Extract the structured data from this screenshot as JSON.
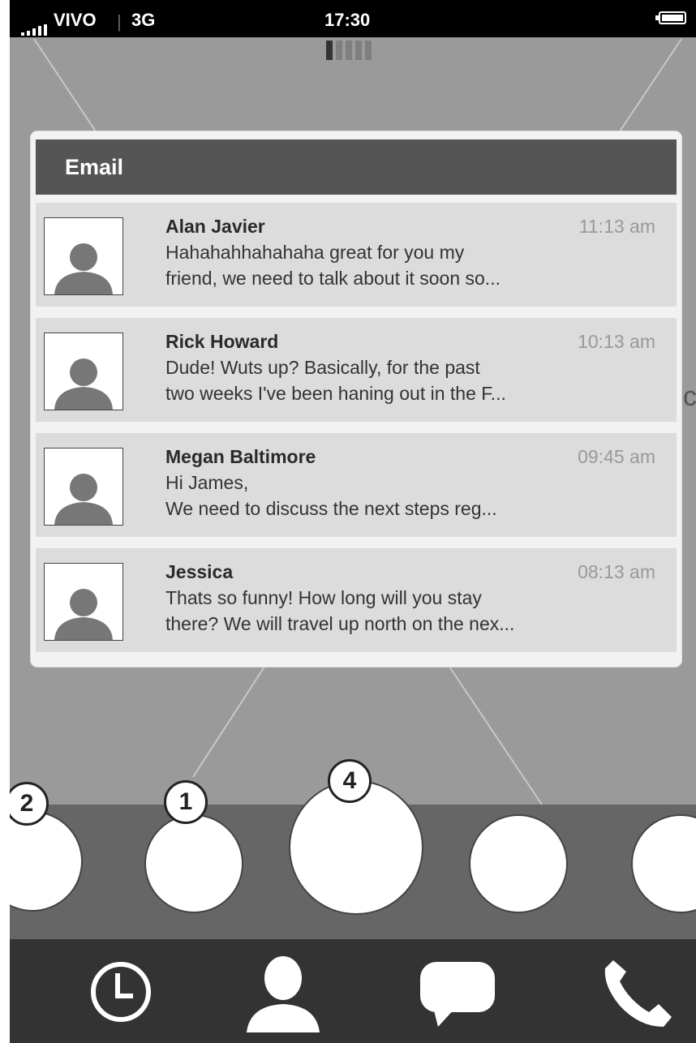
{
  "status_bar": {
    "signal_icon": "signal-bars-icon",
    "carrier": "VIVO",
    "separator": "|",
    "network": "3G",
    "time": "17:30",
    "battery_icon": "battery-icon"
  },
  "page_indicator": {
    "pages": 5,
    "active": 1
  },
  "email_panel": {
    "title": "Email",
    "messages": [
      {
        "sender": "Alan Javier",
        "time": "11:13 am",
        "line1": "Hahahahhahahaha great for you my",
        "line2": "friend, we need to talk about it soon so..."
      },
      {
        "sender": "Rick Howard",
        "time": "10:13 am",
        "line1": "Dude! Wuts up? Basically, for the past",
        "line2": "two weeks I've been haning out in the F..."
      },
      {
        "sender": "Megan Baltimore",
        "time": "09:45 am",
        "line1": "Hi James,",
        "line2": "We need to discuss the next steps reg..."
      },
      {
        "sender": "Jessica",
        "time": "08:13 am",
        "line1": "Thats so funny! How long will you stay",
        "line2": "there? We will travel up north on the nex..."
      }
    ]
  },
  "background_cut_text": "ch",
  "contact_dock": {
    "badges": [
      "2",
      "1",
      "4"
    ]
  },
  "tab_bar": {
    "tabs": [
      {
        "icon": "clock-icon"
      },
      {
        "icon": "person-icon"
      },
      {
        "icon": "chat-bubble-icon"
      },
      {
        "icon": "phone-icon"
      }
    ]
  },
  "colors": {
    "background": "#9a9a9a",
    "header": "#555555",
    "row": "#dcdcdc",
    "dock": "#666666",
    "tabbar": "#333333"
  }
}
